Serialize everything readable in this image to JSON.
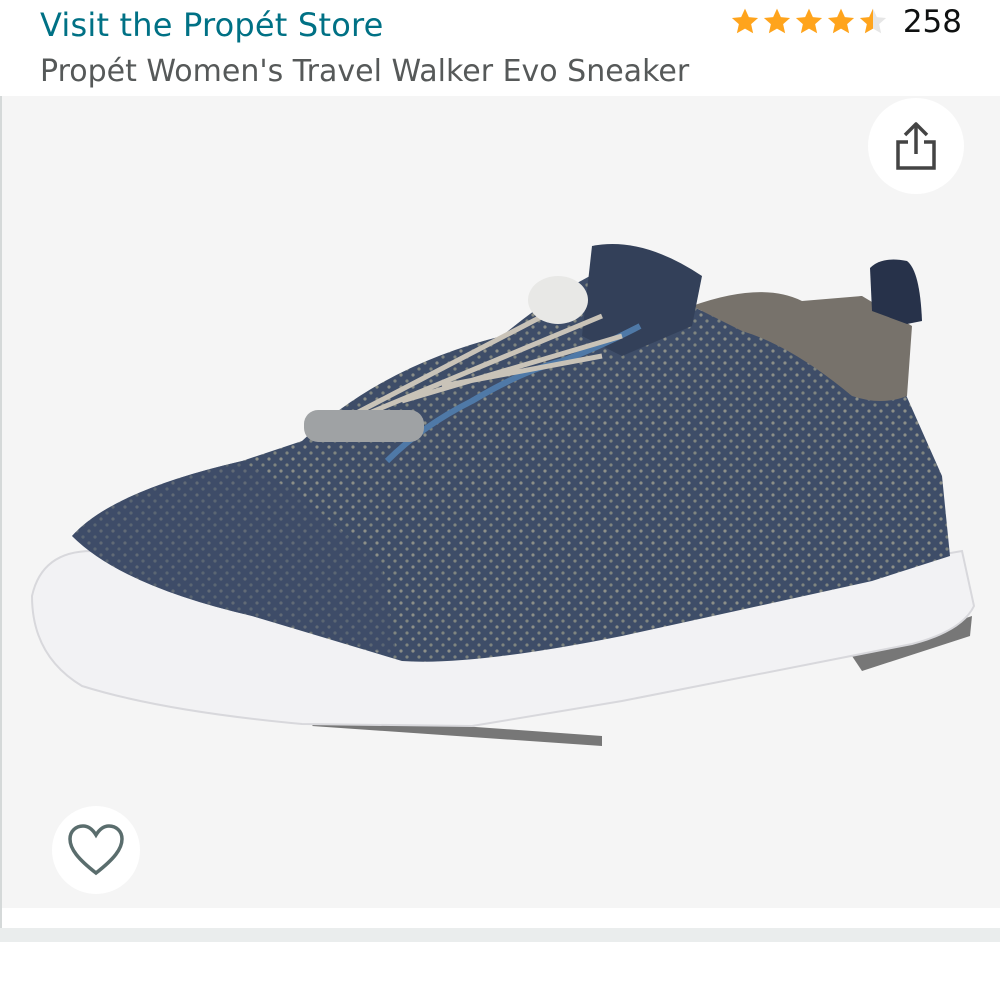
{
  "header": {
    "store_link": "Visit the Propét Store",
    "rating_count": "258",
    "rating_value": 4.5,
    "title": "Propét Women's Travel Walker Evo Sneaker"
  },
  "icons": {
    "share": "share-icon",
    "wishlist": "heart-icon",
    "star": "star-icon"
  },
  "colors": {
    "link": "#007185",
    "star": "#FFA41C",
    "title": "#565959"
  }
}
